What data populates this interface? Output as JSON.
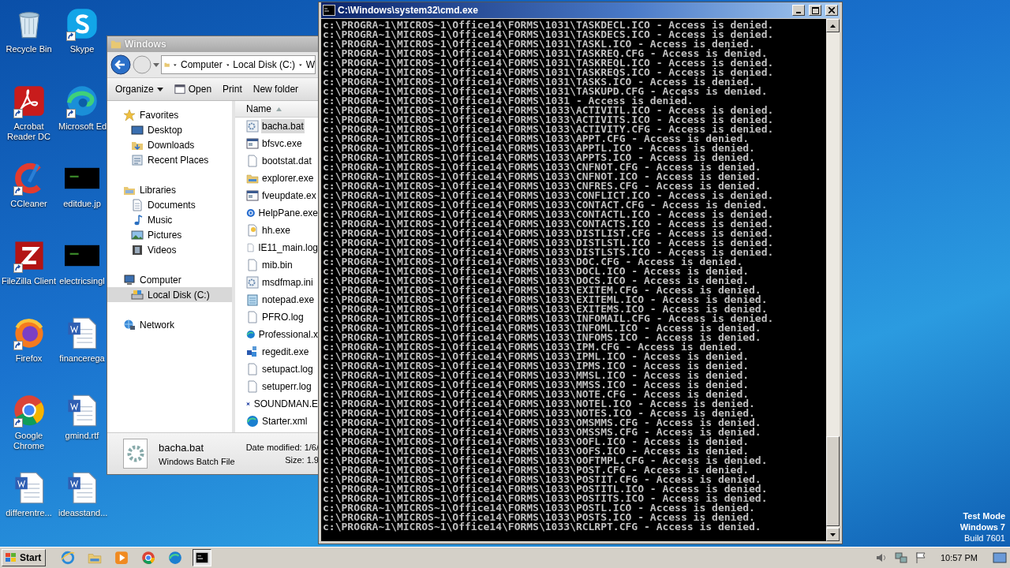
{
  "desktop_icons": [
    {
      "label": "Recycle Bin",
      "kind": "recycle",
      "shortcut": false
    },
    {
      "label": "Skype",
      "kind": "skype",
      "shortcut": true
    },
    {
      "label": "Acrobat Reader DC",
      "kind": "acrobat",
      "shortcut": true
    },
    {
      "label": "Microsoft Ed",
      "kind": "edge",
      "shortcut": true
    },
    {
      "label": "CCleaner",
      "kind": "ccleaner",
      "shortcut": true
    },
    {
      "label": "editdue.jp",
      "kind": "thumbnail",
      "shortcut": false
    },
    {
      "label": "FileZilla Client",
      "kind": "filezilla",
      "shortcut": true
    },
    {
      "label": "electricsingl",
      "kind": "thumbnail",
      "shortcut": false
    },
    {
      "label": "Firefox",
      "kind": "firefox",
      "shortcut": true
    },
    {
      "label": "financerega",
      "kind": "word",
      "shortcut": false
    },
    {
      "label": "Google Chrome",
      "kind": "chrome",
      "shortcut": true
    },
    {
      "label": "gmind.rtf",
      "kind": "word",
      "shortcut": false
    },
    {
      "label": "differentre...",
      "kind": "word",
      "shortcut": false
    },
    {
      "label": "ideasstand...",
      "kind": "word",
      "shortcut": false
    }
  ],
  "explorer": {
    "title": "Windows",
    "breadcrumbs": [
      "Computer",
      "Local Disk (C:)",
      "W"
    ],
    "toolbar": [
      {
        "label": "Organize",
        "kind": "menu"
      },
      {
        "label": "Open",
        "kind": "open"
      },
      {
        "label": "Print",
        "kind": "plain"
      },
      {
        "label": "New folder",
        "kind": "plain"
      }
    ],
    "nav": [
      {
        "label": "Favorites",
        "kind": "star",
        "selected": false,
        "children": [
          {
            "label": "Desktop",
            "kind": "desktop",
            "selected": false
          },
          {
            "label": "Downloads",
            "kind": "download",
            "selected": false
          },
          {
            "label": "Recent Places",
            "kind": "recent",
            "selected": false
          }
        ]
      },
      {
        "label": "Libraries",
        "kind": "library",
        "selected": false,
        "children": [
          {
            "label": "Documents",
            "kind": "document",
            "selected": false
          },
          {
            "label": "Music",
            "kind": "music",
            "selected": false
          },
          {
            "label": "Pictures",
            "kind": "picture",
            "selected": false
          },
          {
            "label": "Videos",
            "kind": "video",
            "selected": false
          }
        ]
      },
      {
        "label": "Computer",
        "kind": "computer",
        "selected": false,
        "children": [
          {
            "label": "Local Disk (C:)",
            "kind": "disk",
            "selected": true
          }
        ]
      },
      {
        "label": "Network",
        "kind": "network",
        "selected": false
      }
    ],
    "column_header": "Name",
    "files": [
      {
        "name": "bacha.bat",
        "kind": "gear",
        "selected": true
      },
      {
        "name": "bfsvc.exe",
        "kind": "app",
        "selected": false
      },
      {
        "name": "bootstat.dat",
        "kind": "page",
        "selected": false
      },
      {
        "name": "explorer.exe",
        "kind": "folder",
        "selected": false
      },
      {
        "name": "fveupdate.ex",
        "kind": "app",
        "selected": false
      },
      {
        "name": "HelpPane.exe",
        "kind": "help",
        "selected": false
      },
      {
        "name": "hh.exe",
        "kind": "hh",
        "selected": false
      },
      {
        "name": "IE11_main.log",
        "kind": "page",
        "selected": false
      },
      {
        "name": "mib.bin",
        "kind": "page",
        "selected": false
      },
      {
        "name": "msdfmap.ini",
        "kind": "gear",
        "selected": false
      },
      {
        "name": "notepad.exe",
        "kind": "notepad",
        "selected": false
      },
      {
        "name": "PFRO.log",
        "kind": "page",
        "selected": false
      },
      {
        "name": "Professional.x",
        "kind": "edge",
        "selected": false
      },
      {
        "name": "regedit.exe",
        "kind": "regedit",
        "selected": false
      },
      {
        "name": "setupact.log",
        "kind": "page",
        "selected": false
      },
      {
        "name": "setuperr.log",
        "kind": "page",
        "selected": false
      },
      {
        "name": "SOUNDMAN.E",
        "kind": "soundman",
        "selected": false
      },
      {
        "name": "Starter.xml",
        "kind": "edge",
        "selected": false
      }
    ],
    "details": {
      "name": "bacha.bat",
      "type": "Windows Batch File",
      "date": "Date modified: 1/6/",
      "size": "Size: 1.9"
    }
  },
  "cmd": {
    "title": "C:\\Windows\\system32\\cmd.exe",
    "lines": [
      "c:\\PROGRA~1\\MICROS~1\\Office14\\FORMS\\1031\\TASKDECL.ICO - Access is denied.",
      "c:\\PROGRA~1\\MICROS~1\\Office14\\FORMS\\1031\\TASKDECS.ICO - Access is denied.",
      "c:\\PROGRA~1\\MICROS~1\\Office14\\FORMS\\1031\\TASKL.ICO - Access is denied.",
      "c:\\PROGRA~1\\MICROS~1\\Office14\\FORMS\\1031\\TASKREQ.CFG - Access is denied.",
      "c:\\PROGRA~1\\MICROS~1\\Office14\\FORMS\\1031\\TASKREQL.ICO - Access is denied.",
      "c:\\PROGRA~1\\MICROS~1\\Office14\\FORMS\\1031\\TASKREQS.ICO - Access is denied.",
      "c:\\PROGRA~1\\MICROS~1\\Office14\\FORMS\\1031\\TASKS.ICO - Access is denied.",
      "c:\\PROGRA~1\\MICROS~1\\Office14\\FORMS\\1031\\TASKUPD.CFG - Access is denied.",
      "c:\\PROGRA~1\\MICROS~1\\Office14\\FORMS\\1031 - Access is denied.",
      "c:\\PROGRA~1\\MICROS~1\\Office14\\FORMS\\1033\\ACTIVITL.ICO - Access is denied.",
      "c:\\PROGRA~1\\MICROS~1\\Office14\\FORMS\\1033\\ACTIVITS.ICO - Access is denied.",
      "c:\\PROGRA~1\\MICROS~1\\Office14\\FORMS\\1033\\ACTIVITY.CFG - Access is denied.",
      "c:\\PROGRA~1\\MICROS~1\\Office14\\FORMS\\1033\\APPT.CFG - Access is denied.",
      "c:\\PROGRA~1\\MICROS~1\\Office14\\FORMS\\1033\\APPTL.ICO - Access is denied.",
      "c:\\PROGRA~1\\MICROS~1\\Office14\\FORMS\\1033\\APPTS.ICO - Access is denied.",
      "c:\\PROGRA~1\\MICROS~1\\Office14\\FORMS\\1033\\CNFNOT.CFG - Access is denied.",
      "c:\\PROGRA~1\\MICROS~1\\Office14\\FORMS\\1033\\CNFNOT.ICO - Access is denied.",
      "c:\\PROGRA~1\\MICROS~1\\Office14\\FORMS\\1033\\CNFRES.CFG - Access is denied.",
      "c:\\PROGRA~1\\MICROS~1\\Office14\\FORMS\\1033\\CONFLICT.ICO - Access is denied.",
      "c:\\PROGRA~1\\MICROS~1\\Office14\\FORMS\\1033\\CONTACT.CFG - Access is denied.",
      "c:\\PROGRA~1\\MICROS~1\\Office14\\FORMS\\1033\\CONTACTL.ICO - Access is denied.",
      "c:\\PROGRA~1\\MICROS~1\\Office14\\FORMS\\1033\\CONTACTS.ICO - Access is denied.",
      "c:\\PROGRA~1\\MICROS~1\\Office14\\FORMS\\1033\\DISTLIST.CFG - Access is denied.",
      "c:\\PROGRA~1\\MICROS~1\\Office14\\FORMS\\1033\\DISTLSTL.ICO - Access is denied.",
      "c:\\PROGRA~1\\MICROS~1\\Office14\\FORMS\\1033\\DISTLSTS.ICO - Access is denied.",
      "c:\\PROGRA~1\\MICROS~1\\Office14\\FORMS\\1033\\DOC.CFG - Access is denied.",
      "c:\\PROGRA~1\\MICROS~1\\Office14\\FORMS\\1033\\DOCL.ICO - Access is denied.",
      "c:\\PROGRA~1\\MICROS~1\\Office14\\FORMS\\1033\\DOCS.ICO - Access is denied.",
      "c:\\PROGRA~1\\MICROS~1\\Office14\\FORMS\\1033\\EXITEM.CFG - Access is denied.",
      "c:\\PROGRA~1\\MICROS~1\\Office14\\FORMS\\1033\\EXITEML.ICO - Access is denied.",
      "c:\\PROGRA~1\\MICROS~1\\Office14\\FORMS\\1033\\EXITEMS.ICO - Access is denied.",
      "c:\\PROGRA~1\\MICROS~1\\Office14\\FORMS\\1033\\INFOMAIL.CFG - Access is denied.",
      "c:\\PROGRA~1\\MICROS~1\\Office14\\FORMS\\1033\\INFOML.ICO - Access is denied.",
      "c:\\PROGRA~1\\MICROS~1\\Office14\\FORMS\\1033\\INFOMS.ICO - Access is denied.",
      "c:\\PROGRA~1\\MICROS~1\\Office14\\FORMS\\1033\\IPM.CFG - Access is denied.",
      "c:\\PROGRA~1\\MICROS~1\\Office14\\FORMS\\1033\\IPML.ICO - Access is denied.",
      "c:\\PROGRA~1\\MICROS~1\\Office14\\FORMS\\1033\\IPMS.ICO - Access is denied.",
      "c:\\PROGRA~1\\MICROS~1\\Office14\\FORMS\\1033\\MMSL.ICO - Access is denied.",
      "c:\\PROGRA~1\\MICROS~1\\Office14\\FORMS\\1033\\MMSS.ICO - Access is denied.",
      "c:\\PROGRA~1\\MICROS~1\\Office14\\FORMS\\1033\\NOTE.CFG - Access is denied.",
      "c:\\PROGRA~1\\MICROS~1\\Office14\\FORMS\\1033\\NOTEL.ICO - Access is denied.",
      "c:\\PROGRA~1\\MICROS~1\\Office14\\FORMS\\1033\\NOTES.ICO - Access is denied.",
      "c:\\PROGRA~1\\MICROS~1\\Office14\\FORMS\\1033\\OMSMMS.CFG - Access is denied.",
      "c:\\PROGRA~1\\MICROS~1\\Office14\\FORMS\\1033\\OMSSMS.CFG - Access is denied.",
      "c:\\PROGRA~1\\MICROS~1\\Office14\\FORMS\\1033\\OOFL.ICO - Access is denied.",
      "c:\\PROGRA~1\\MICROS~1\\Office14\\FORMS\\1033\\OOFS.ICO - Access is denied.",
      "c:\\PROGRA~1\\MICROS~1\\Office14\\FORMS\\1033\\OOFTMPL.CFG - Access is denied.",
      "c:\\PROGRA~1\\MICROS~1\\Office14\\FORMS\\1033\\POST.CFG - Access is denied.",
      "c:\\PROGRA~1\\MICROS~1\\Office14\\FORMS\\1033\\POSTIT.CFG - Access is denied.",
      "c:\\PROGRA~1\\MICROS~1\\Office14\\FORMS\\1033\\POSTITL.ICO - Access is denied.",
      "c:\\PROGRA~1\\MICROS~1\\Office14\\FORMS\\1033\\POSTITS.ICO - Access is denied.",
      "c:\\PROGRA~1\\MICROS~1\\Office14\\FORMS\\1033\\POSTL.ICO - Access is denied.",
      "c:\\PROGRA~1\\MICROS~1\\Office14\\FORMS\\1033\\POSTS.ICO - Access is denied.",
      "c:\\PROGRA~1\\MICROS~1\\Office14\\FORMS\\1033\\RCLRPT.CFG - Access is denied."
    ]
  },
  "os_notice": [
    "Test Mode",
    "Windows 7",
    "Build 7601"
  ],
  "taskbar": {
    "start": "Start",
    "apps": [
      {
        "kind": "ie",
        "selected": false
      },
      {
        "kind": "folder",
        "selected": false
      },
      {
        "kind": "media",
        "selected": false
      },
      {
        "kind": "chrome",
        "selected": false
      },
      {
        "kind": "edge",
        "selected": false
      },
      {
        "kind": "cmd",
        "selected": true
      }
    ],
    "clock": "10:57 PM"
  }
}
